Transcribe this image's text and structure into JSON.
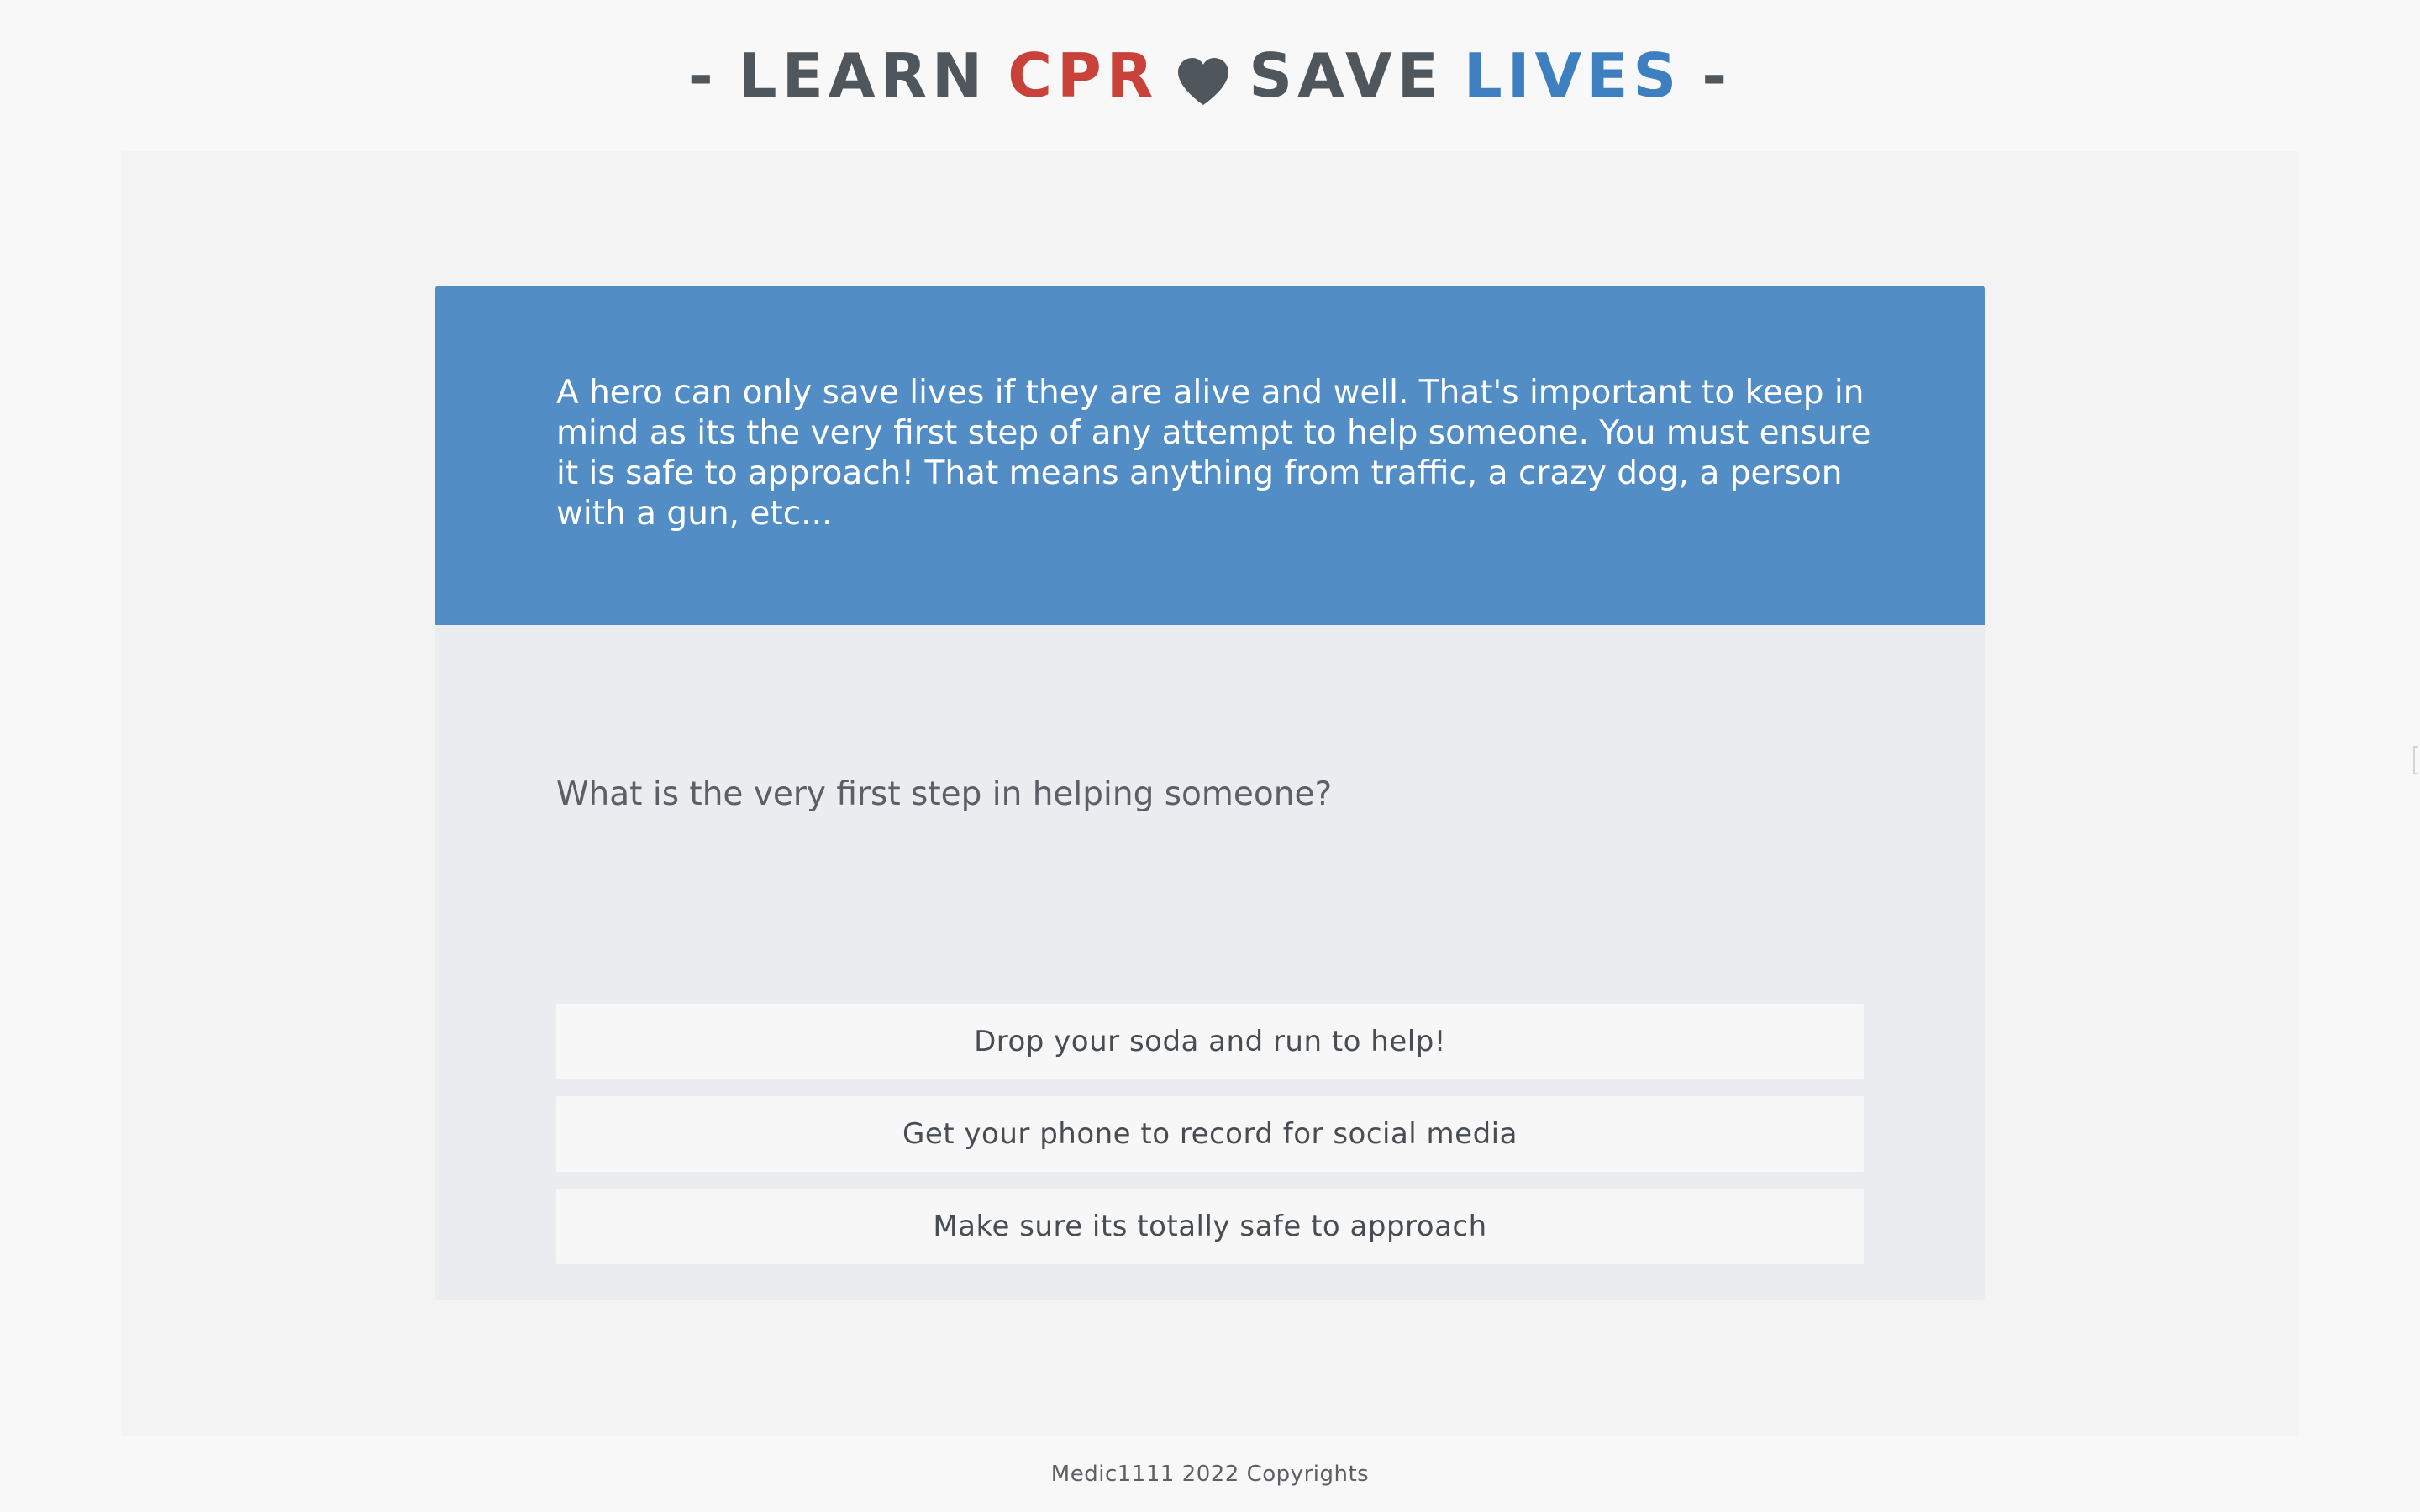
{
  "header": {
    "prefix": "-",
    "word_learn": "LEARN",
    "word_cpr": "CPR",
    "heart_icon": "heart-icon",
    "word_save": "SAVE",
    "word_lives": "LIVES",
    "suffix": "-"
  },
  "colors": {
    "title_gray": "#4f565c",
    "cpr_red": "#c8423a",
    "lives_blue": "#3d7fbf",
    "banner_blue": "#528dc6",
    "card_bg": "#ebecef",
    "stage_bg": "#f3f3f3",
    "page_bg": "#f8f8f8",
    "answer_bg": "#f7f7f7"
  },
  "lesson": {
    "info_text": "A hero can only save lives if they are alive and well. That's important to keep in mind as its the very first step of any attempt to help someone. You must ensure it is safe to approach! That means anything from traffic, a crazy dog, a person with a gun, etc...",
    "question": "What is the very first step in helping someone?",
    "answers": [
      "Drop your soda and run to help!",
      "Get your phone to record for social media",
      "Make sure its totally safe to approach"
    ]
  },
  "footer": {
    "text": "Medic1111 2022 Copyrights"
  }
}
